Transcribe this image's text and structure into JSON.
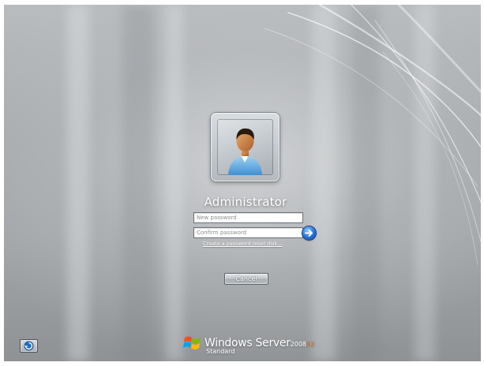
{
  "user": {
    "name": "Administrator"
  },
  "fields": {
    "new_password_placeholder": "New password",
    "confirm_password_placeholder": "Confirm password"
  },
  "links": {
    "reset_disk": "Create a password reset disk..."
  },
  "buttons": {
    "cancel": "Cancel",
    "submit_icon": "arrow-right-icon",
    "ease_of_access_icon": "ease-of-access-icon"
  },
  "branding": {
    "product": "Windows Server",
    "version": "2008",
    "release": "R2",
    "edition": "Standard",
    "logo_icon": "windows-flag-icon"
  },
  "colors": {
    "background": "#a6a9ac",
    "accent_blue": "#2f7fe0",
    "release_orange": "#e8702a"
  }
}
